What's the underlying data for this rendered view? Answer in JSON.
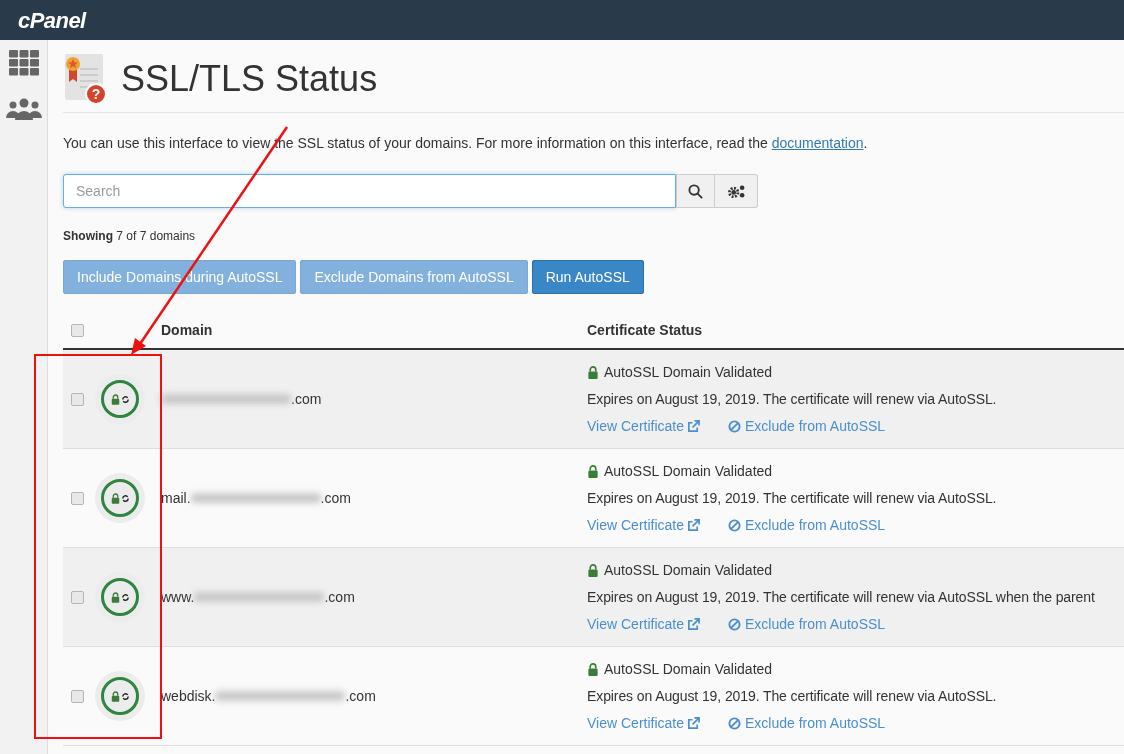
{
  "header": {
    "logo": "cPanel"
  },
  "page": {
    "icon_glyph": "?",
    "title": "SSL/TLS Status",
    "description": "You can use this interface to view the SSL status of your domains. For more information on this interface, read the ",
    "link": "documentation",
    "description_end": "."
  },
  "search": {
    "placeholder": "Search"
  },
  "summary": {
    "label": "Showing",
    "count": "7 of 7 domains"
  },
  "actions": [
    {
      "label": "Include Domains during AutoSSL",
      "kind": "light"
    },
    {
      "label": "Exclude Domains from AutoSSL",
      "kind": "light"
    },
    {
      "label": "Run AutoSSL",
      "kind": "primary"
    }
  ],
  "table": {
    "columns": [
      "Domain",
      "Certificate Status"
    ],
    "header_checked": false,
    "rows": [
      {
        "checked": false,
        "domain_suffix": ".com",
        "status": "AutoSSL Domain Validated",
        "expiry": "Expires on August 19, 2019. The certificate will renew via AutoSSL.",
        "view": "View Certificate",
        "exclude": "Exclude from AutoSSL"
      },
      {
        "checked": false,
        "domain_prefix": "mail.",
        "domain_suffix": ".com",
        "status": "AutoSSL Domain Validated",
        "expiry": "Expires on August 19, 2019. The certificate will renew via AutoSSL.",
        "view": "View Certificate",
        "exclude": "Exclude from AutoSSL"
      },
      {
        "checked": false,
        "domain_prefix": "www.",
        "domain_suffix": ".com",
        "status": "AutoSSL Domain Validated",
        "expiry": "Expires on August 19, 2019. The certificate will renew via AutoSSL when the parent",
        "view": "View Certificate",
        "exclude": "Exclude from AutoSSL"
      },
      {
        "checked": false,
        "domain_prefix": "webdisk.",
        "domain_suffix": ".com",
        "status": "AutoSSL Domain Validated",
        "expiry": "Expires on August 19, 2019. The certificate will renew via AutoSSL.",
        "view": "View Certificate",
        "exclude": "Exclude from AutoSSL"
      }
    ]
  }
}
